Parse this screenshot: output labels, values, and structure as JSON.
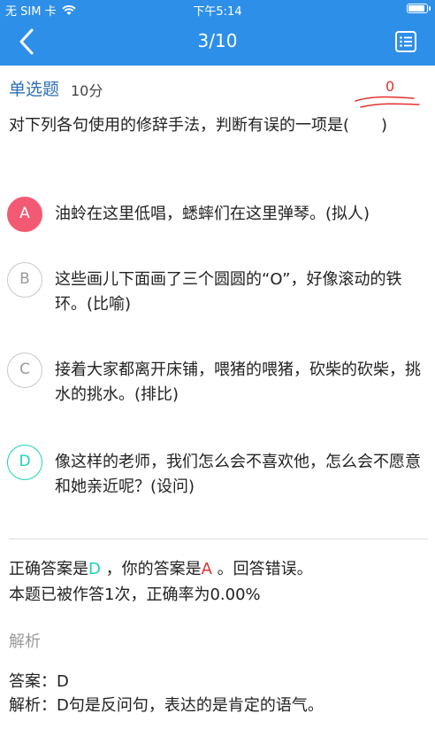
{
  "status_bar": {
    "carrier": "无 SIM 卡",
    "time": "下午5:14",
    "battery_level": 0.9
  },
  "nav": {
    "title": "3/10",
    "back_icon": "chevron-left-icon",
    "list_icon": "list-icon"
  },
  "question": {
    "type": "单选题",
    "score": "10分",
    "result_score": "0",
    "stem": "对下列各句使用的修辞手法，判断有误的一项是(　　)"
  },
  "options": [
    {
      "letter": "A",
      "text": "油蛉在这里低唱，蟋蟀们在这里弹琴。(拟人)",
      "state": "selected-wrong"
    },
    {
      "letter": "B",
      "text": "这些画儿下面画了三个圆圆的“O”，好像滚动的铁环。(比喻)",
      "state": "normal"
    },
    {
      "letter": "C",
      "text": "接着大家都离开床铺，喂猪的喂猪，砍柴的砍柴，挑水的挑水。(排比)",
      "state": "normal"
    },
    {
      "letter": "D",
      "text": "像这样的老师，我们怎么会不喜欢他，怎么会不愿意和她亲近呢？(设问)",
      "state": "correct"
    }
  ],
  "result": {
    "correct_prefix": "正确答案是",
    "correct_answer": "D",
    "your_prefix": " ，你的答案是",
    "your_answer": "A",
    "verdict": " 。回答错误。",
    "stats": "本题已被作答1次，正确率为0.00%"
  },
  "analysis": {
    "title": "解析",
    "answer_line": "答案：D",
    "explain_line": "解析：D句是反问句，表达的是肯定的语气。"
  },
  "colors": {
    "primary": "#2e8fe8",
    "wrong": "#f25a73",
    "correct": "#1fd0b5",
    "red_text": "#e23030"
  }
}
